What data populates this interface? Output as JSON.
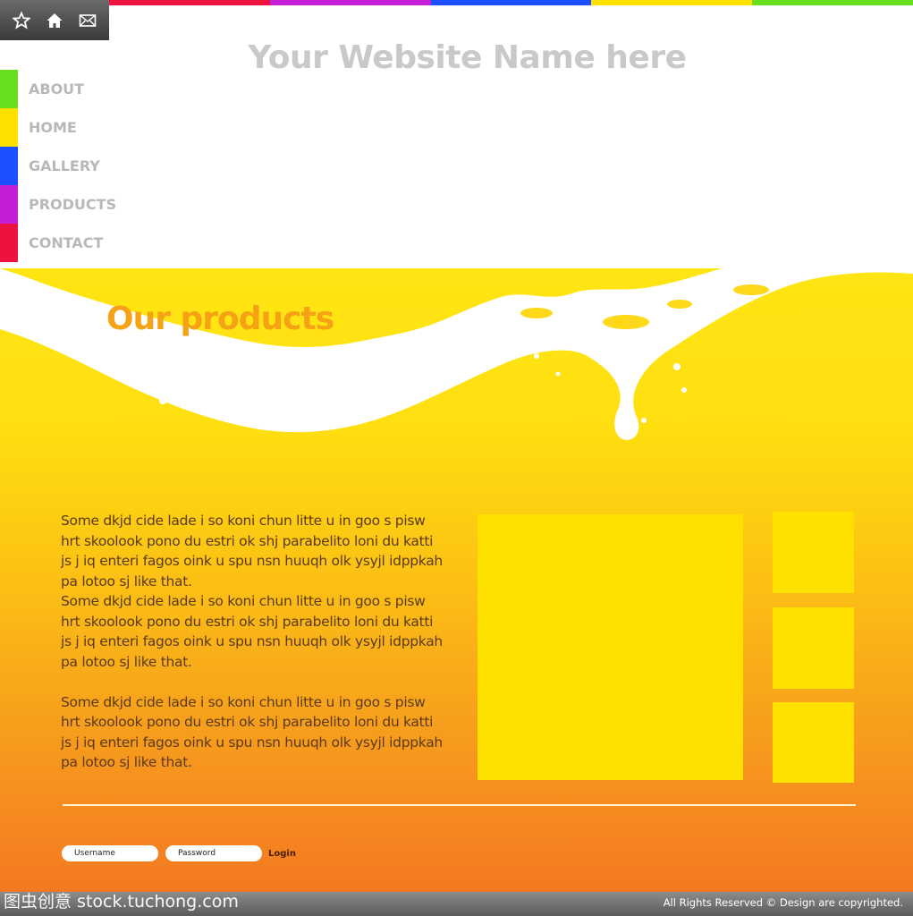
{
  "colors": {
    "green": "#66e01c",
    "yellow": "#ffe100",
    "blue": "#1c4fff",
    "purple": "#c41ed6",
    "red": "#ee1240",
    "orange_title": "#f5a214",
    "nav_text": "#b8b8b8",
    "site_name": "#c9c9c9"
  },
  "top_icons": [
    "star-icon",
    "home-icon",
    "mail-icon"
  ],
  "header": {
    "site_name": "Your Website Name here"
  },
  "nav": {
    "items": [
      {
        "label": "ABOUT",
        "color": "#66e01c"
      },
      {
        "label": "HOME",
        "color": "#ffe100"
      },
      {
        "label": "GALLERY",
        "color": "#1c4fff"
      },
      {
        "label": "PRODUCTS",
        "color": "#c41ed6"
      },
      {
        "label": "CONTACT",
        "color": "#ee1240"
      }
    ]
  },
  "products": {
    "title": "Our products",
    "paragraphs": [
      "Some dkjd  cide lade i so koni chun litte u in goo s pisw hrt skoolook pono du estri ok shj parabelito loni du katti js j iq enteri fagos oink u spu nsn huuqh olk ysyjl idppkah pa lotoo sj like that.",
      "Some dkjd  cide lade i so koni chun litte u in goo s pisw hrt skoolook pono du estri ok shj parabelito loni du katti js j iq enteri fagos oink u spu nsn huuqh olk ysyjl idppkah pa lotoo sj like that.",
      "Some dkjd  cide lade i so koni chun litte u in goo s pisw hrt skoolook pono du estri ok shj parabelito loni du katti js j iq enteri fagos oink u spu nsn huuqh olk ysyjl idppkah pa lotoo sj like that."
    ]
  },
  "login": {
    "username_placeholder": "Username",
    "password_placeholder": "Password",
    "button_label": "Login"
  },
  "footer": {
    "watermark": "图虫创意 stock.tuchong.com",
    "copyright": "All Rights Reserved ©  Design are copyrighted."
  }
}
